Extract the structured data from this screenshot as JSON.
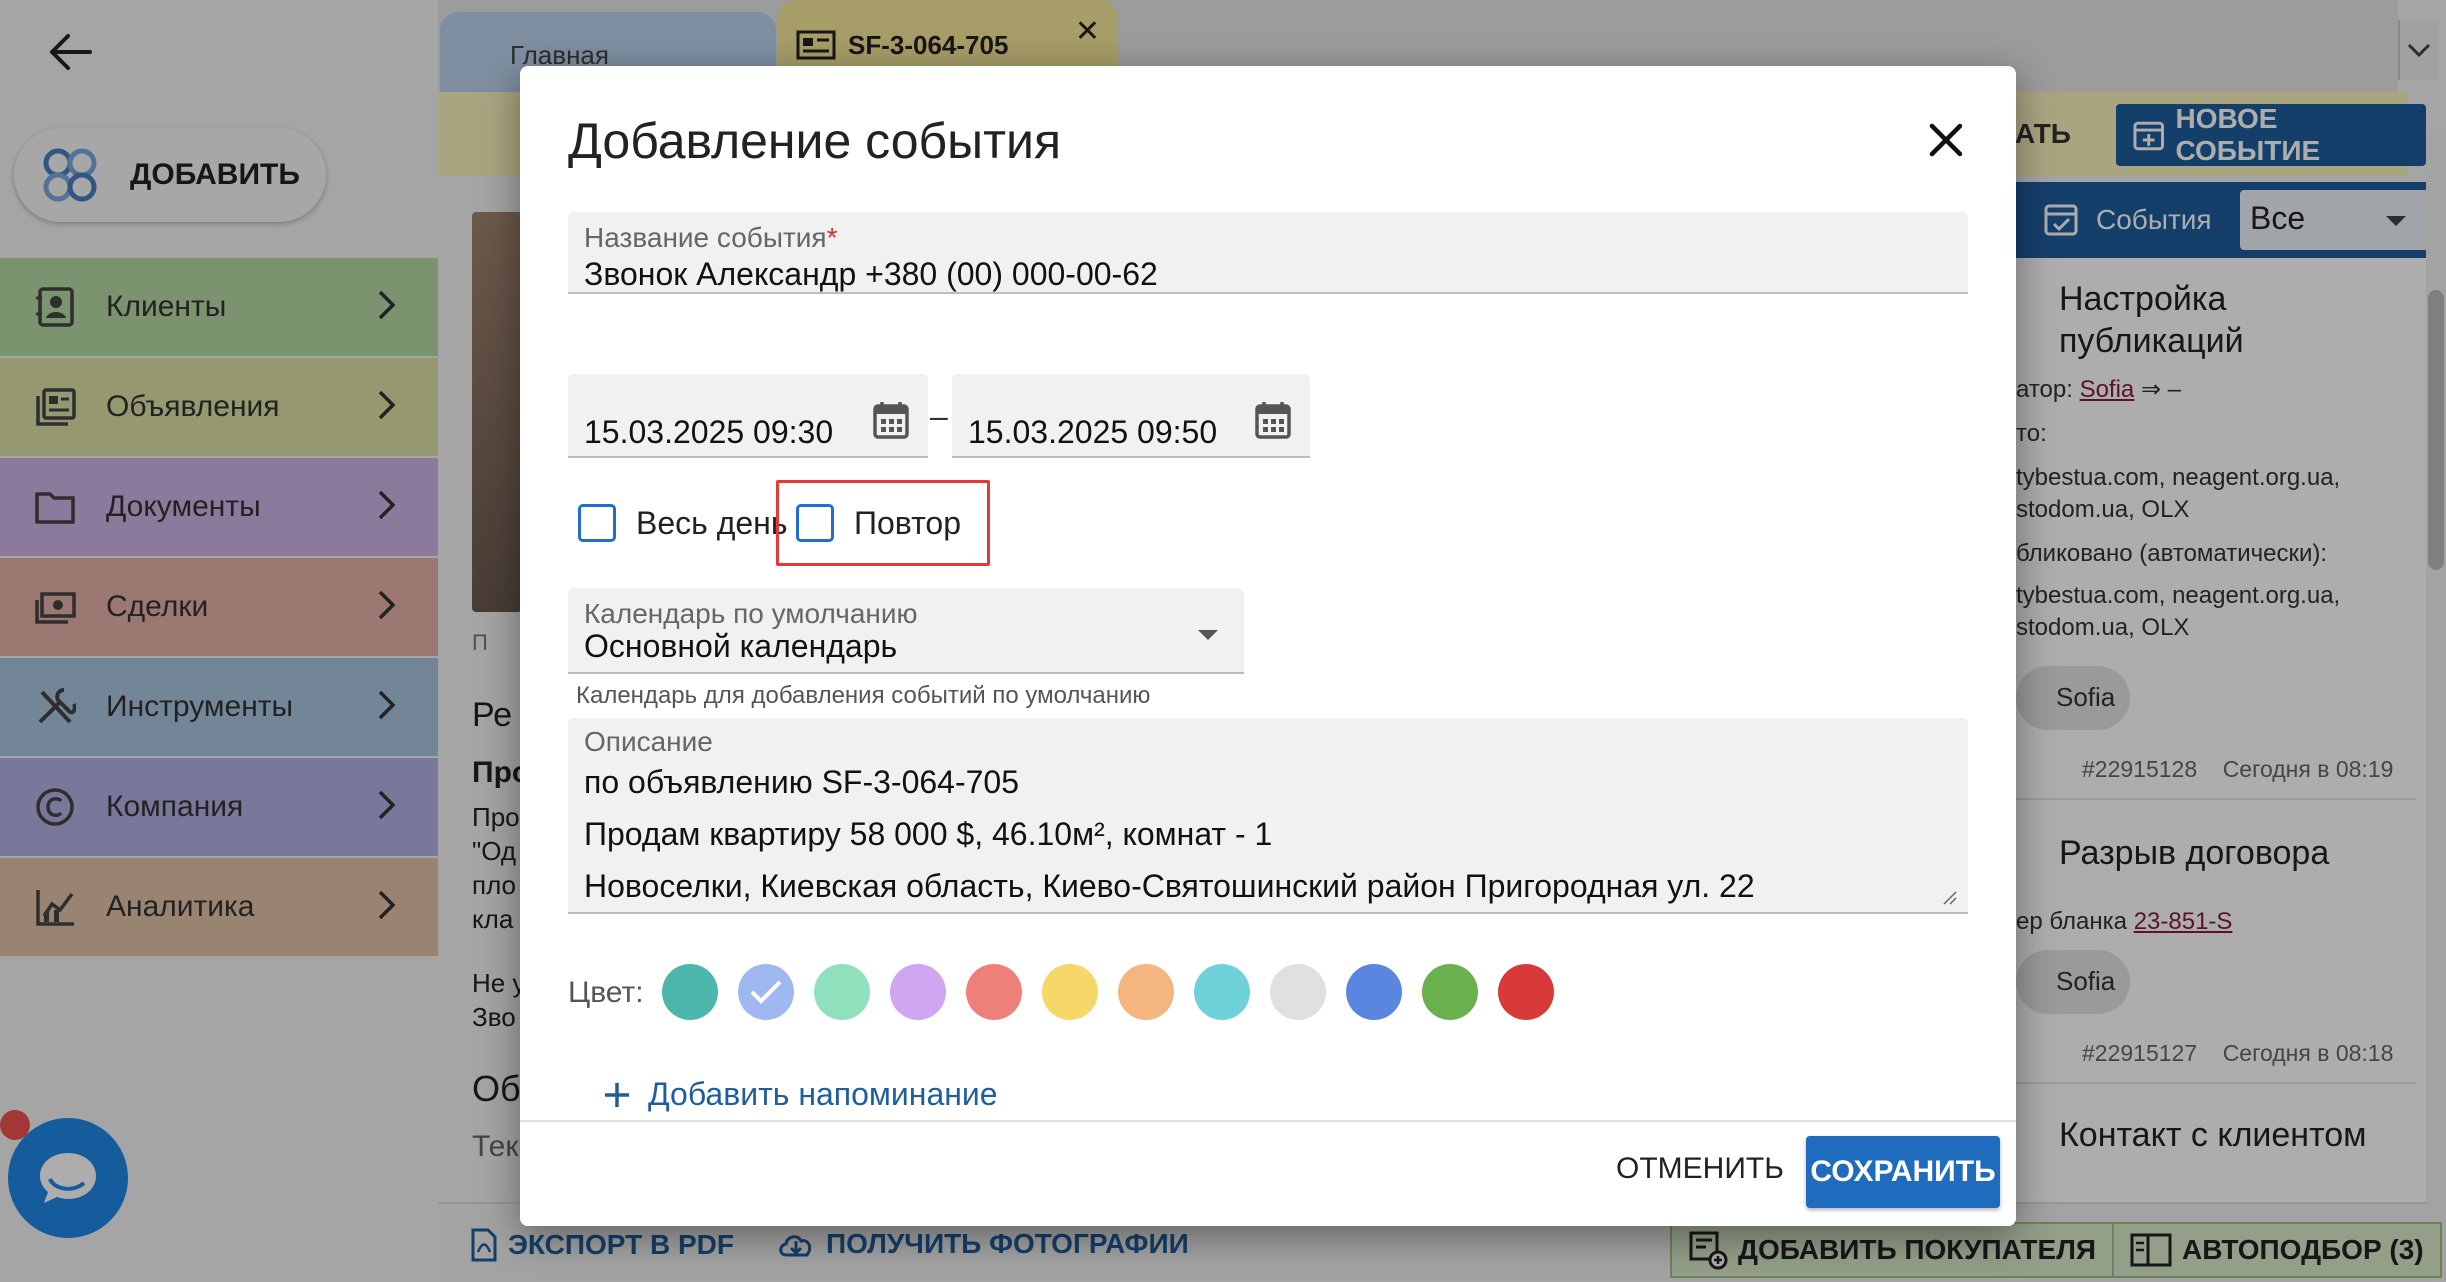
{
  "app": {
    "add_label": "ДОБАВИТЬ",
    "sidebar": [
      {
        "label": "Клиенты",
        "color": "#b5d9a3",
        "icon": "contacts-icon"
      },
      {
        "label": "Объявления",
        "color": "#dde0a4",
        "icon": "listings-icon"
      },
      {
        "label": "Документы",
        "color": "#cdb4e6",
        "icon": "folder-icon"
      },
      {
        "label": "Сделки",
        "color": "#e6b2a8",
        "icon": "money-icon"
      },
      {
        "label": "Инструменты",
        "color": "#a9c6e0",
        "icon": "tools-icon"
      },
      {
        "label": "Компания",
        "color": "#b3b2e4",
        "icon": "copyright-icon"
      },
      {
        "label": "Аналитика",
        "color": "#e2c3a8",
        "icon": "analytics-icon"
      }
    ],
    "tabs": {
      "home": "Главная",
      "listing": "SF-3-064-705"
    },
    "toolbar": {
      "partial_button": "ВАТЬ",
      "new_event": "НОВОЕ СОБЫТИЕ"
    },
    "events": {
      "header": "События",
      "filter_value": "Все",
      "items": [
        {
          "title_line1": "Настройка",
          "title_line2": "публикаций",
          "author_prefix": "атор: ",
          "author": "Sofia",
          "author_suffix": " ⇒ –",
          "line_to": "то:",
          "sites1a": "tybestua.com, neagent.org.ua,",
          "sites1b": "stodom.ua, OLX",
          "published": "бликовано (автоматически):",
          "sites2a": "tybestua.com, neagent.org.ua,",
          "sites2b": "stodom.ua, OLX",
          "chip": "Sofia",
          "id": "#22915128",
          "time": "Сегодня в 08:19"
        },
        {
          "title": "Разрыв договора",
          "form_prefix": "ер бланка ",
          "form_link": "23-851-S",
          "chip": "Sofia",
          "id": "#22915127",
          "time": "Сегодня в 08:18"
        },
        {
          "title": "Контакт с клиентом"
        }
      ]
    },
    "content": {
      "link_fragment": "П",
      "heading_fragment": "Ре",
      "bold_fragment": "Про",
      "lines": [
        "Про",
        "\"Од",
        "пло",
        "кла"
      ],
      "line_ne": "Не у",
      "line_zvo": "Зво",
      "heading2_fragment": "Об",
      "line_tek": "Тек"
    },
    "bottom": {
      "export_pdf": "ЭКСПОРТ В PDF",
      "get_photos": "ПОЛУЧИТЬ ФОТОГРАФИИ",
      "add_buyer": "ДОБАВИТЬ ПОКУПАТЕЛЯ",
      "autoselect": "АВТОПОДБОР (3)"
    }
  },
  "modal": {
    "title": "Добавление события",
    "name_label": "Название события",
    "name_required_mark": "*",
    "name_value": "Звонок Александр +380 (00) 000-00-62",
    "date_start": "15.03.2025 09:30",
    "date_separator": "–",
    "date_end": "15.03.2025 09:50",
    "all_day_label": "Весь день",
    "all_day_checked": false,
    "repeat_label": "Повтор",
    "repeat_checked": false,
    "calendar_label": "Календарь по умолчанию",
    "calendar_value": "Основной календарь",
    "calendar_helper": "Календарь для добавления событий по умолчанию",
    "description_label": "Описание",
    "description_lines": [
      " по объявлению SF-3-064-705",
      "Продам квартиру 58 000 $, 46.10м², комнат - 1",
      "Новоселки, Киевская область, Киево-Святошинский район Пригородная ул. 22"
    ],
    "color_label": "Цвет:",
    "colors": [
      "#4db6ac",
      "#9fb8f2",
      "#8fe0bc",
      "#cfa6f2",
      "#ef7f79",
      "#f6d868",
      "#f5b57f",
      "#6fd2da",
      "#e0e0e0",
      "#5b86e0",
      "#6ab04c",
      "#d83a3a"
    ],
    "selected_color_index": 1,
    "add_reminder": "Добавить напоминание",
    "cancel": "ОТМЕНИТЬ",
    "save": "СОХРАНИТЬ"
  }
}
